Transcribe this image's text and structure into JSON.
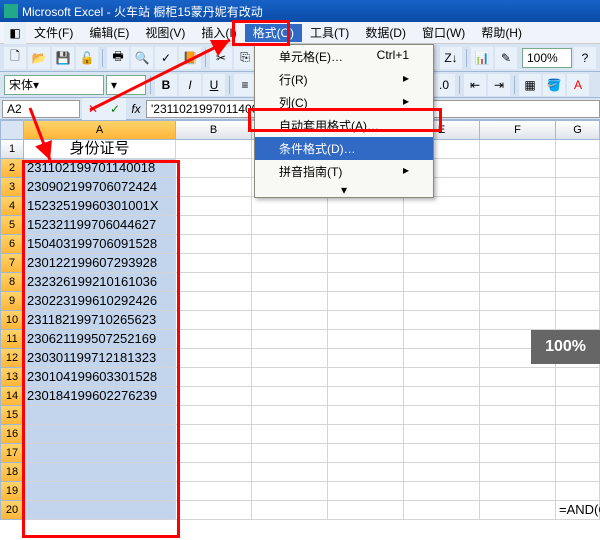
{
  "title": "Microsoft Excel - 火车站 橱柜15蒙丹妮有改动",
  "menus": [
    "文件(F)",
    "编辑(E)",
    "视图(V)",
    "插入(I)",
    "格式(O)",
    "工具(T)",
    "数据(D)",
    "窗口(W)",
    "帮助(H)"
  ],
  "dropdown": {
    "items": [
      {
        "label": "单元格(E)…",
        "shortcut": "Ctrl+1"
      },
      {
        "label": "行(R)",
        "arrow": "▸"
      },
      {
        "label": "列(C)",
        "arrow": "▸"
      },
      {
        "label": "自动套用格式(A)…",
        "shortcut": ""
      },
      {
        "label": "条件格式(D)…",
        "shortcut": "",
        "hl": true
      },
      {
        "label": "拼音指南(T)",
        "arrow": "▸"
      },
      {
        "expand": "▾"
      }
    ]
  },
  "font": {
    "name": "宋体",
    "size": ""
  },
  "toolbar_zoom": "100%",
  "name_box": "A2",
  "formula": "'231102199701140018",
  "columns": [
    {
      "label": "A",
      "w": 152,
      "sel": true
    },
    {
      "label": "B",
      "w": 76
    },
    {
      "label": "C",
      "w": 76
    },
    {
      "label": "D",
      "w": 76
    },
    {
      "label": "E",
      "w": 76
    },
    {
      "label": "F",
      "w": 76
    },
    {
      "label": "G",
      "w": 44
    }
  ],
  "header_cell": "身份证号",
  "ids": [
    "231102199701140018",
    "230902199706072424",
    "15232519960301001X",
    "152321199706044627",
    "150403199706091528",
    "230122199607293928",
    "232326199210161036",
    "230223199610292426",
    "231182199710265623",
    "230621199507252169",
    "230301199712181323",
    "230104199603301528",
    "230184199602276239"
  ],
  "tail_formula": "=AND(COUN",
  "zoom_badge": "100%",
  "row_count": 20
}
